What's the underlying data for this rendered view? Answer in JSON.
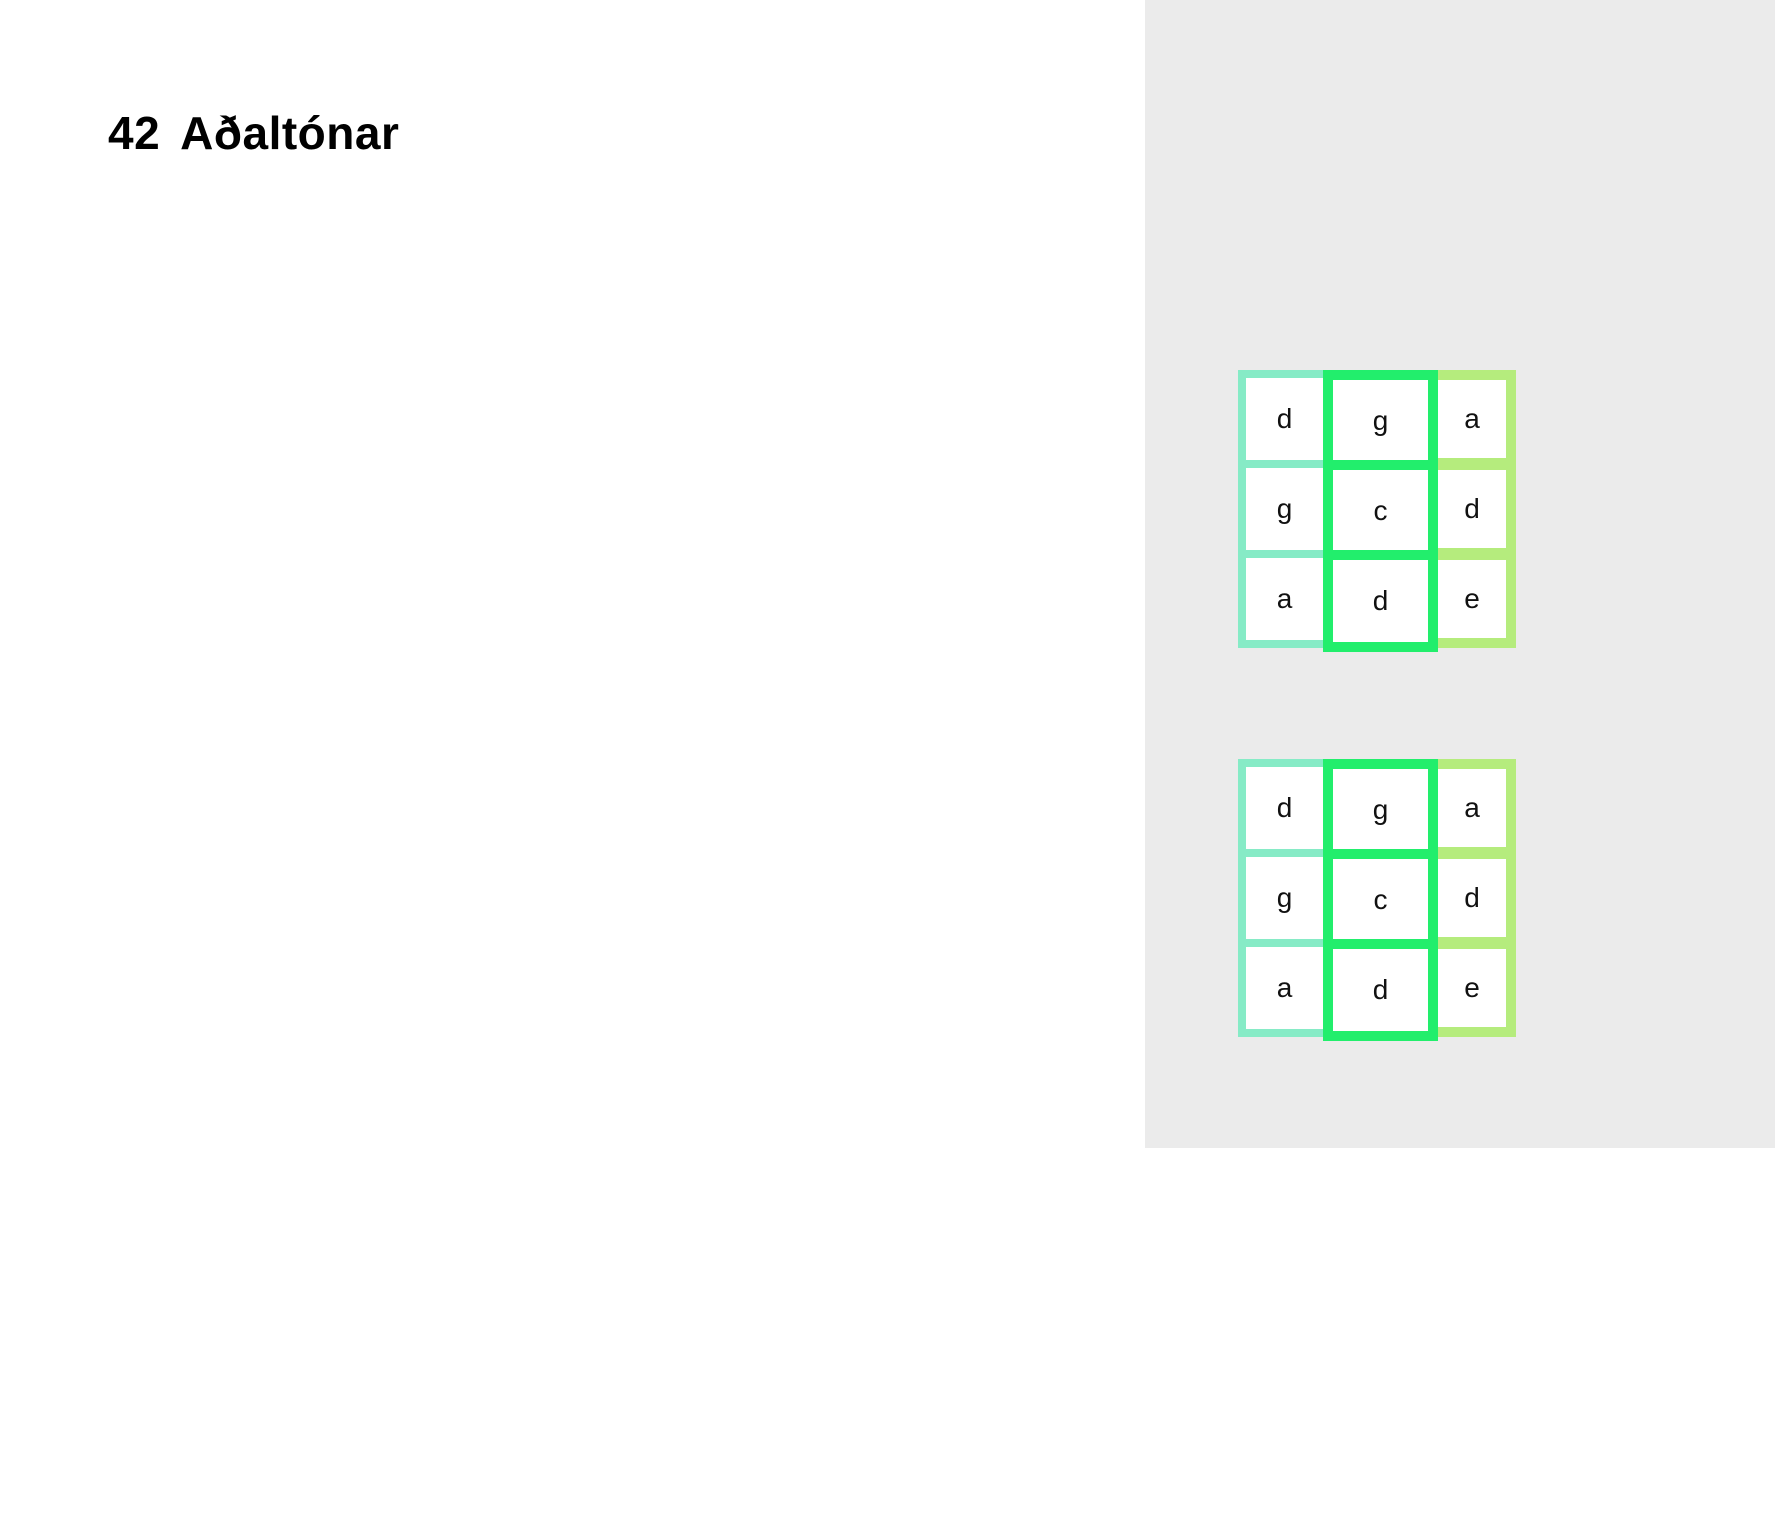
{
  "title": {
    "number": "42",
    "text": "Aðaltónar"
  },
  "colors": {
    "panel_background": "#ebebeb",
    "column_1_border": "#86ebc6",
    "column_2_border": "#22ee6c",
    "column_3_border": "#b5ec7d"
  },
  "grids": [
    {
      "rows": [
        [
          "d",
          "g",
          "a"
        ],
        [
          "g",
          "c",
          "d"
        ],
        [
          "a",
          "d",
          "e"
        ]
      ]
    },
    {
      "rows": [
        [
          "d",
          "g",
          "a"
        ],
        [
          "g",
          "c",
          "d"
        ],
        [
          "a",
          "d",
          "e"
        ]
      ]
    }
  ]
}
